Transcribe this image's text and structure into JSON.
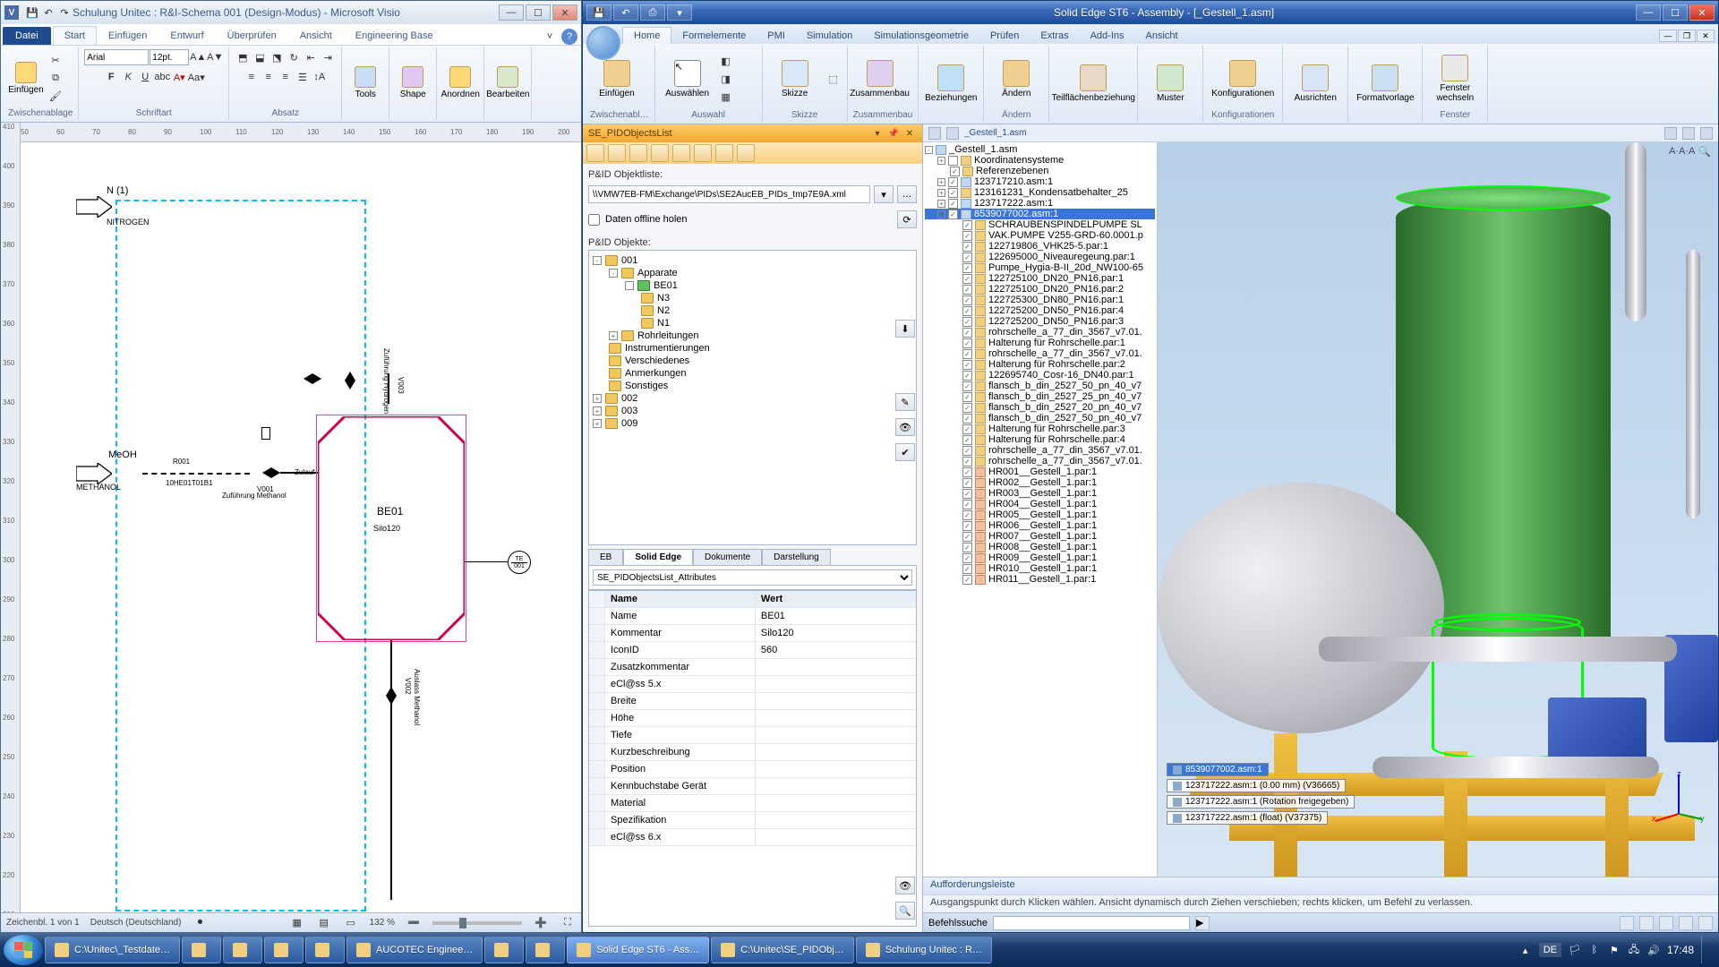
{
  "visio": {
    "title": "Schulung Unitec : R&I-Schema 001 (Design-Modus) - Microsoft Visio",
    "file_tab": "Datei",
    "tabs": [
      "Start",
      "Einfügen",
      "Entwurf",
      "Überprüfen",
      "Ansicht",
      "Engineering Base"
    ],
    "active_tab": "Start",
    "ribbon": {
      "zwischenablage": "Zwischenablage",
      "einfugen": "Einfügen",
      "schriftart": "Schriftart",
      "absatz": "Absatz",
      "tools": "Tools",
      "shape": "Shape",
      "anordnen": "Anordnen",
      "bearbeiten": "Bearbeiten",
      "font_name": "Arial",
      "font_size": "12pt."
    },
    "schematic": {
      "n_label": "N (1)",
      "nitrogen": "NITROGEN",
      "meoh": "MeOH",
      "methanol": "METHANOL",
      "r001": "R001",
      "pipe": "10HE01T01B1",
      "zufuhrung": "Zuführung Methanol",
      "zulauf": "Zulauf",
      "v003": "V003",
      "v001": "V001",
      "v002": "V002",
      "zufHydrogen": "Zuführung Hydrogen",
      "auslass": "Auslass Methanol",
      "be01": "BE01",
      "silo": "Silo120",
      "te": "TE",
      "te_num": "001"
    },
    "status": {
      "sheet": "Zeichenbl. 1 von 1",
      "lang": "Deutsch (Deutschland)",
      "zoom": "132 %"
    }
  },
  "se": {
    "title": "Solid Edge ST6 - Assembly - [_Gestell_1.asm]",
    "tabs": [
      "Home",
      "Formelemente",
      "PMI",
      "Simulation",
      "Simulationsgeometrie",
      "Prüfen",
      "Extras",
      "Add-Ins",
      "Ansicht"
    ],
    "active_tab": "Home",
    "ribbon_groups": {
      "zwischenablage": {
        "label": "Zwischenabl…",
        "btn": "Einfügen"
      },
      "auswahl": {
        "label": "Auswahl",
        "btn": "Auswählen"
      },
      "skizze": {
        "label": "Skizze",
        "btn": "Skizze"
      },
      "zusammenbau": {
        "label": "Zusammenbau",
        "btn": "Zusammenbau"
      },
      "beziehungen": {
        "btn": "Beziehungen"
      },
      "andern": {
        "label": "Ändern",
        "btn": "Ändern"
      },
      "teilflache": {
        "btn": "Teilflächenbeziehung"
      },
      "muster": {
        "btn": "Muster"
      },
      "konfig": {
        "label": "Konfigurationen",
        "btn": "Konfigurationen"
      },
      "ausrichten": {
        "btn": "Ausrichten"
      },
      "formatvorlage": {
        "btn": "Formatvorlage"
      },
      "fenster": {
        "label": "Fenster",
        "btn": "Fenster wechseln"
      }
    },
    "dock": {
      "title": "SE_PIDObjectsList",
      "objektliste_label": "P&ID Objektliste:",
      "path": "\\\\VMW7EB-FM\\Exchange\\PIDs\\SE2AucEB_PIDs_tmp7E9A.xml",
      "offline": "Daten offline holen",
      "objekte_label": "P&ID Objekte:",
      "tree": {
        "root": "001",
        "apparate": "Apparate",
        "be01": "BE01",
        "n3": "N3",
        "n2": "N2",
        "n1": "N1",
        "rohrleitungen": "Rohrleitungen",
        "instrument": "Instrumentierungen",
        "versch": "Verschiedenes",
        "anmerk": "Anmerkungen",
        "sonst": "Sonstiges",
        "002": "002",
        "003": "003",
        "009": "009"
      },
      "prop_tabs": [
        "EB",
        "Solid Edge",
        "Dokumente",
        "Darstellung"
      ],
      "active_prop_tab": "Solid Edge",
      "attr_combo": "SE_PIDObjectsList_Attributes",
      "col_name": "Name",
      "col_wert": "Wert",
      "props": [
        {
          "n": "Name",
          "v": "BE01"
        },
        {
          "n": "Kommentar",
          "v": "Silo120"
        },
        {
          "n": "IconID",
          "v": "560"
        },
        {
          "n": "Zusatzkommentar",
          "v": ""
        },
        {
          "n": "eCl@ss 5.x",
          "v": ""
        },
        {
          "n": "Breite",
          "v": ""
        },
        {
          "n": "Höhe",
          "v": ""
        },
        {
          "n": "Tiefe",
          "v": ""
        },
        {
          "n": "Kurzbeschreibung",
          "v": ""
        },
        {
          "n": "Position",
          "v": ""
        },
        {
          "n": "Kennbuchstabe Gerät",
          "v": ""
        },
        {
          "n": "Material",
          "v": ""
        },
        {
          "n": "Spezifikation",
          "v": ""
        },
        {
          "n": "eCl@ss 6.x",
          "v": ""
        }
      ]
    },
    "asm_path": "_Gestell_1.asm",
    "asm_tree": [
      {
        "l": "_Gestell_1.asm",
        "d": 0,
        "exp": "-",
        "asm": true,
        "nc": true
      },
      {
        "l": "Koordinatensysteme",
        "d": 1,
        "exp": "+"
      },
      {
        "l": "Referenzebenen",
        "d": 1,
        "cb": true
      },
      {
        "l": "123717210.asm:1",
        "d": 1,
        "exp": "+",
        "cb": true,
        "asm": true
      },
      {
        "l": "123161231_Kondensatbehalter_25",
        "d": 1,
        "exp": "+",
        "cb": true
      },
      {
        "l": "123717222.asm:1",
        "d": 1,
        "exp": "+",
        "cb": true,
        "asm": true
      },
      {
        "l": "8539077002.asm:1",
        "d": 1,
        "exp": "+",
        "cb": true,
        "asm": true,
        "sel": true
      },
      {
        "l": "SCHRAUBENSPINDELPUMPE SL",
        "d": 2,
        "cb": true
      },
      {
        "l": "VAK.PUMPE V255-GRD-60.0001.p",
        "d": 2,
        "cb": true
      },
      {
        "l": "122719806_VHK25-5.par:1",
        "d": 2,
        "cb": true
      },
      {
        "l": "122695000_Niveauregeung.par:1",
        "d": 2,
        "cb": true
      },
      {
        "l": "Pumpe_Hygia-B-II_20d_NW100-65",
        "d": 2,
        "cb": true
      },
      {
        "l": "122725100_DN20_PN16.par:1",
        "d": 2,
        "cb": true
      },
      {
        "l": "122725100_DN20_PN16.par:2",
        "d": 2,
        "cb": true
      },
      {
        "l": "122725300_DN80_PN16.par:1",
        "d": 2,
        "cb": true
      },
      {
        "l": "122725200_DN50_PN16.par:4",
        "d": 2,
        "cb": true
      },
      {
        "l": "122725200_DN50_PN16.par:3",
        "d": 2,
        "cb": true
      },
      {
        "l": "rohrschelle_a_77_din_3567_v7.01.",
        "d": 2,
        "cb": true
      },
      {
        "l": "Halterung für Rohrschelle.par:1",
        "d": 2,
        "cb": true
      },
      {
        "l": "rohrschelle_a_77_din_3567_v7.01.",
        "d": 2,
        "cb": true
      },
      {
        "l": "Halterung für Rohrschelle.par:2",
        "d": 2,
        "cb": true
      },
      {
        "l": "122695740_Cosr-16_DN40.par:1",
        "d": 2,
        "cb": true
      },
      {
        "l": "flansch_b_din_2527_50_pn_40_v7",
        "d": 2,
        "cb": true
      },
      {
        "l": "flansch_b_din_2527_25_pn_40_v7",
        "d": 2,
        "cb": true
      },
      {
        "l": "flansch_b_din_2527_20_pn_40_v7",
        "d": 2,
        "cb": true
      },
      {
        "l": "flansch_b_din_2527_50_pn_40_v7",
        "d": 2,
        "cb": true
      },
      {
        "l": "Halterung für Rohrschelle.par:3",
        "d": 2,
        "cb": true
      },
      {
        "l": "Halterung für Rohrschelle.par:4",
        "d": 2,
        "cb": true
      },
      {
        "l": "rohrschelle_a_77_din_3567_v7.01.",
        "d": 2,
        "cb": true
      },
      {
        "l": "rohrschelle_a_77_din_3567_v7.01.",
        "d": 2,
        "cb": true
      },
      {
        "l": "HR001__Gestell_1.par:1",
        "d": 2,
        "cb": true,
        "hr": true
      },
      {
        "l": "HR002__Gestell_1.par:1",
        "d": 2,
        "cb": true,
        "hr": true
      },
      {
        "l": "HR003__Gestell_1.par:1",
        "d": 2,
        "cb": true,
        "hr": true
      },
      {
        "l": "HR004__Gestell_1.par:1",
        "d": 2,
        "cb": true,
        "hr": true
      },
      {
        "l": "HR005__Gestell_1.par:1",
        "d": 2,
        "cb": true,
        "hr": true
      },
      {
        "l": "HR006__Gestell_1.par:1",
        "d": 2,
        "cb": true,
        "hr": true
      },
      {
        "l": "HR007__Gestell_1.par:1",
        "d": 2,
        "cb": true,
        "hr": true
      },
      {
        "l": "HR008__Gestell_1.par:1",
        "d": 2,
        "cb": true,
        "hr": true
      },
      {
        "l": "HR009__Gestell_1.par:1",
        "d": 2,
        "cb": true,
        "hr": true
      },
      {
        "l": "HR010__Gestell_1.par:1",
        "d": 2,
        "cb": true,
        "hr": true
      },
      {
        "l": "HR011__Gestell_1.par:1",
        "d": 2,
        "cb": true,
        "hr": true
      }
    ],
    "overlay": [
      {
        "t": "8539077002.asm:1",
        "sel": true
      },
      {
        "t": "123717222.asm:1   (0.00 mm)   (V36665)"
      },
      {
        "t": "123717222.asm:1   (Rotation freigegeben)"
      },
      {
        "t": "123717222.asm:1   (float)   (V37375)"
      }
    ],
    "prompt_title": "Aufforderungsleiste",
    "prompt_text": "Ausgangspunkt durch Klicken wählen. Ansicht dynamisch durch Ziehen verschieben; rechts klicken, um Befehl zu verlassen.",
    "cmd_label": "Befehlssuche"
  },
  "taskbar": {
    "items": [
      {
        "label": "C:\\Unitec\\_Testdate…"
      },
      {
        "label": ""
      },
      {
        "label": ""
      },
      {
        "label": ""
      },
      {
        "label": ""
      },
      {
        "label": "AUCOTEC    Enginee…"
      },
      {
        "label": ""
      },
      {
        "label": ""
      },
      {
        "label": "Solid Edge ST6 - Ass…",
        "active": true
      },
      {
        "label": "C:\\Unitec\\SE_PIDObj…"
      },
      {
        "label": "Schulung Unitec : R…"
      }
    ],
    "lang": "DE",
    "time": "17:48"
  }
}
